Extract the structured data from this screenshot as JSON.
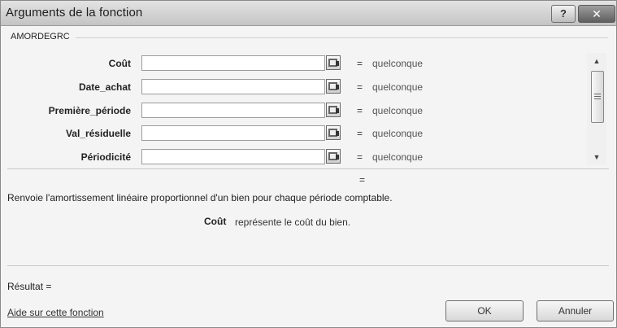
{
  "window": {
    "title": "Arguments de la fonction",
    "help_label": "?",
    "close_label": "✕"
  },
  "function_name": "AMORDEGRC",
  "arguments": [
    {
      "label": "Coût",
      "value": "",
      "result": "quelconque",
      "equals": "="
    },
    {
      "label": "Date_achat",
      "value": "",
      "result": "quelconque",
      "equals": "="
    },
    {
      "label": "Première_période",
      "value": "",
      "result": "quelconque",
      "equals": "="
    },
    {
      "label": "Val_résiduelle",
      "value": "",
      "result": "quelconque",
      "equals": "="
    },
    {
      "label": "Périodicité",
      "value": "",
      "result": "quelconque",
      "equals": "="
    }
  ],
  "formula_result_equals": "=",
  "description": "Renvoie l'amortissement linéaire proportionnel d'un bien pour chaque période comptable.",
  "argument_help": {
    "name": "Coût",
    "text": "représente le coût du bien."
  },
  "result_label": "Résultat =",
  "help_link": "Aide sur cette fonction",
  "buttons": {
    "ok": "OK",
    "cancel": "Annuler"
  },
  "scrollbar": {
    "up_icon": "▲",
    "down_icon": "▼"
  },
  "icons": {
    "collapse": "collapse-dialog-icon"
  }
}
